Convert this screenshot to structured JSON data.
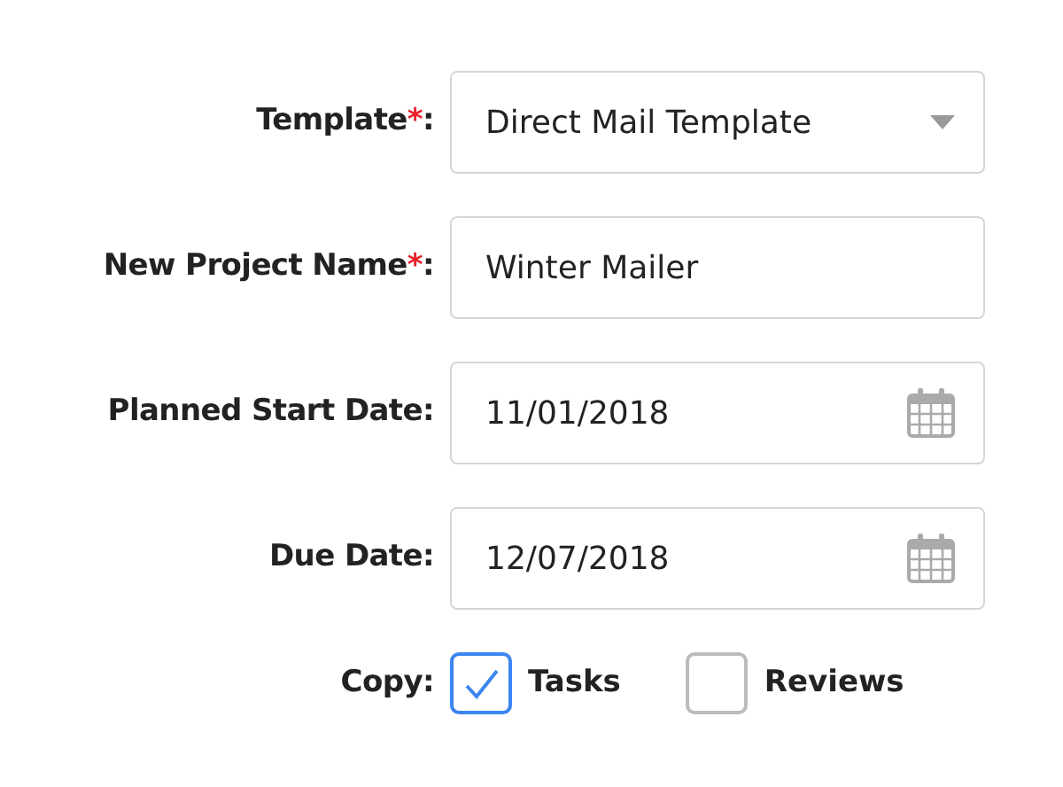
{
  "fields": [
    {
      "label": "Template",
      "required_mark": "*",
      "colon": ":",
      "kind": "select",
      "value": "Direct Mail Template"
    },
    {
      "label": "New Project Name",
      "required_mark": "*",
      "colon": ":",
      "kind": "text",
      "value": "Winter Mailer"
    },
    {
      "label": "Planned Start Date",
      "colon": ":",
      "kind": "date",
      "value": "11/01/2018"
    },
    {
      "label": "Due Date",
      "colon": ":",
      "kind": "date",
      "value": "12/07/2018"
    }
  ],
  "copy": {
    "label": "Copy:",
    "options": [
      {
        "label": "Tasks",
        "checked": true
      },
      {
        "label": "Reviews",
        "checked": false
      }
    ]
  }
}
